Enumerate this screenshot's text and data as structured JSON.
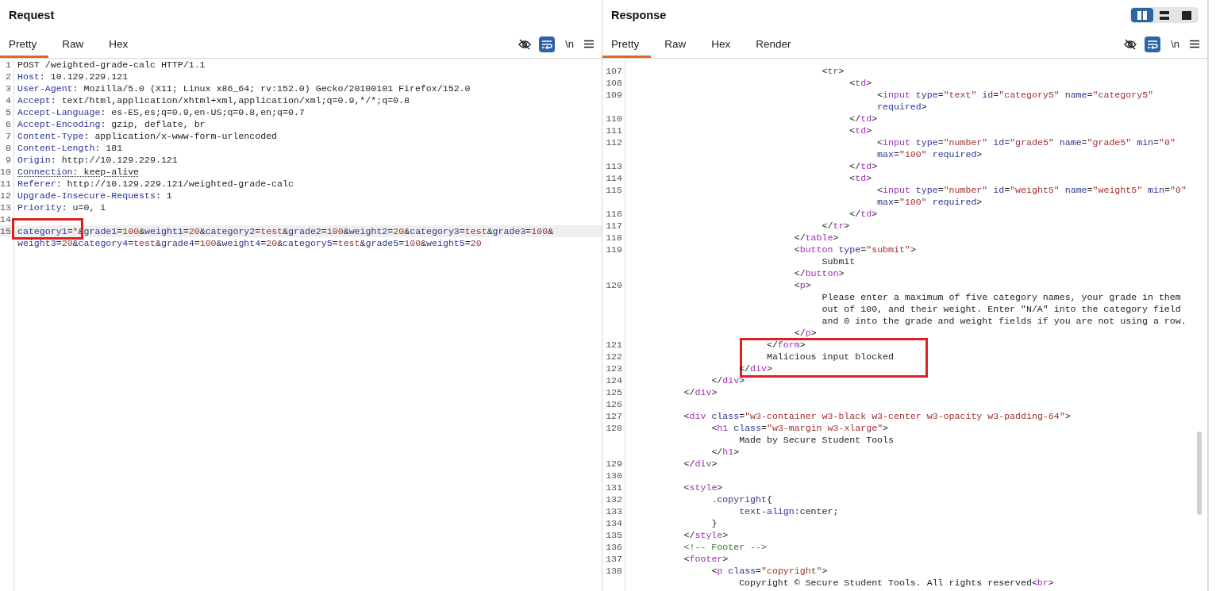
{
  "request": {
    "title": "Request",
    "tabs": [
      {
        "label": "Pretty",
        "selected": true
      },
      {
        "label": "Raw",
        "selected": false
      },
      {
        "label": "Hex",
        "selected": false
      }
    ],
    "toolbar": {
      "wrap": true,
      "newline_label": "\\n"
    },
    "lines": [
      {
        "n": "1",
        "tokens": [
          {
            "kind": "plain",
            "text": "POST /weighted-grade-calc HTTP/1.1"
          }
        ]
      },
      {
        "n": "2",
        "tokens": [
          {
            "kind": "attr",
            "text": "Host"
          },
          {
            "kind": "plain",
            "text": ": 10.129.229.121"
          }
        ]
      },
      {
        "n": "3",
        "tokens": [
          {
            "kind": "attr",
            "text": "User-Agent"
          },
          {
            "kind": "plain",
            "text": ": Mozilla/5.0 (X11; Linux x86_64; rv:152.0) Gecko/20100101 Firefox/152.0"
          }
        ]
      },
      {
        "n": "4",
        "tokens": [
          {
            "kind": "attr",
            "text": "Accept"
          },
          {
            "kind": "plain",
            "text": ": text/html,application/xhtml+xml,application/xml;q=0.9,*/*;q=0.8"
          }
        ]
      },
      {
        "n": "5",
        "tokens": [
          {
            "kind": "attr",
            "text": "Accept-Language"
          },
          {
            "kind": "plain",
            "text": ": es-ES,es;q=0.9,en-US;q=0.8,en;q=0.7"
          }
        ]
      },
      {
        "n": "6",
        "tokens": [
          {
            "kind": "attr",
            "text": "Accept-Encoding"
          },
          {
            "kind": "plain",
            "text": ": gzip, deflate, br"
          }
        ]
      },
      {
        "n": "7",
        "tokens": [
          {
            "kind": "attr",
            "text": "Content-Type"
          },
          {
            "kind": "plain",
            "text": ": application/x-www-form-urlencoded"
          }
        ]
      },
      {
        "n": "8",
        "tokens": [
          {
            "kind": "attr",
            "text": "Content-Length"
          },
          {
            "kind": "plain",
            "text": ": 181"
          }
        ]
      },
      {
        "n": "9",
        "tokens": [
          {
            "kind": "attr",
            "text": "Origin"
          },
          {
            "kind": "plain",
            "text": ": http://10.129.229.121"
          }
        ]
      },
      {
        "n": "10",
        "flagged": true,
        "tokens": [
          {
            "kind": "attr",
            "text": "Connection"
          },
          {
            "kind": "plain",
            "text": ": keep-alive"
          }
        ]
      },
      {
        "n": "11",
        "tokens": [
          {
            "kind": "attr",
            "text": "Referer"
          },
          {
            "kind": "plain",
            "text": ": http://10.129.229.121/weighted-grade-calc"
          }
        ]
      },
      {
        "n": "12",
        "tokens": [
          {
            "kind": "attr",
            "text": "Upgrade-Insecure-Requests"
          },
          {
            "kind": "plain",
            "text": ": 1"
          }
        ]
      },
      {
        "n": "13",
        "tokens": [
          {
            "kind": "attr",
            "text": "Priority"
          },
          {
            "kind": "plain",
            "text": ": u=0, i"
          }
        ]
      },
      {
        "n": "14"
      },
      {
        "n": "15",
        "current": true,
        "tokens": [
          {
            "kind": "attr",
            "text": "category1",
            "boxed": true
          },
          {
            "kind": "plain",
            "text": "=",
            "boxed": true
          },
          {
            "kind": "string",
            "text": "*",
            "boxed": true
          },
          {
            "kind": "plain",
            "text": "&"
          },
          {
            "kind": "attr",
            "text": "grade1"
          },
          {
            "kind": "plain",
            "text": "="
          },
          {
            "kind": "string",
            "text": "100"
          },
          {
            "kind": "plain",
            "text": "&"
          },
          {
            "kind": "attr",
            "text": "weight1"
          },
          {
            "kind": "plain",
            "text": "="
          },
          {
            "kind": "string",
            "text": "20"
          },
          {
            "kind": "plain",
            "text": "&"
          },
          {
            "kind": "attr",
            "text": "category2"
          },
          {
            "kind": "plain",
            "text": "="
          },
          {
            "kind": "string",
            "text": "test"
          },
          {
            "kind": "plain",
            "text": "&"
          },
          {
            "kind": "attr",
            "text": "grade2"
          },
          {
            "kind": "plain",
            "text": "="
          },
          {
            "kind": "string",
            "text": "100"
          },
          {
            "kind": "plain",
            "text": "&"
          },
          {
            "kind": "attr",
            "text": "weight2"
          },
          {
            "kind": "plain",
            "text": "="
          },
          {
            "kind": "string",
            "text": "20"
          },
          {
            "kind": "plain",
            "text": "&"
          },
          {
            "kind": "attr",
            "text": "category3"
          },
          {
            "kind": "plain",
            "text": "="
          },
          {
            "kind": "string",
            "text": "test"
          },
          {
            "kind": "plain",
            "text": "&"
          },
          {
            "kind": "attr",
            "text": "grade3"
          },
          {
            "kind": "plain",
            "text": "="
          },
          {
            "kind": "string",
            "text": "100"
          },
          {
            "kind": "plain",
            "text": "&"
          }
        ]
      },
      {
        "tokens": [
          {
            "kind": "attr",
            "text": "weight3"
          },
          {
            "kind": "plain",
            "text": "="
          },
          {
            "kind": "string",
            "text": "20"
          },
          {
            "kind": "plain",
            "text": "&"
          },
          {
            "kind": "attr",
            "text": "category4"
          },
          {
            "kind": "plain",
            "text": "="
          },
          {
            "kind": "string",
            "text": "test"
          },
          {
            "kind": "plain",
            "text": "&"
          },
          {
            "kind": "attr",
            "text": "grade4"
          },
          {
            "kind": "plain",
            "text": "="
          },
          {
            "kind": "string",
            "text": "100"
          },
          {
            "kind": "plain",
            "text": "&"
          },
          {
            "kind": "attr",
            "text": "weight4"
          },
          {
            "kind": "plain",
            "text": "="
          },
          {
            "kind": "string",
            "text": "20"
          },
          {
            "kind": "plain",
            "text": "&"
          },
          {
            "kind": "attr",
            "text": "category5"
          },
          {
            "kind": "plain",
            "text": "="
          },
          {
            "kind": "string",
            "text": "test"
          },
          {
            "kind": "plain",
            "text": "&"
          },
          {
            "kind": "attr",
            "text": "grade5"
          },
          {
            "kind": "plain",
            "text": "="
          },
          {
            "kind": "string",
            "text": "100"
          },
          {
            "kind": "plain",
            "text": "&"
          },
          {
            "kind": "attr",
            "text": "weight5"
          },
          {
            "kind": "plain",
            "text": "="
          },
          {
            "kind": "string",
            "text": "20"
          }
        ]
      }
    ]
  },
  "response": {
    "title": "Response",
    "layout_buttons": [
      {
        "kind": "columns",
        "selected": true
      },
      {
        "kind": "rows",
        "selected": false
      },
      {
        "kind": "single",
        "selected": false
      }
    ],
    "tabs": [
      {
        "label": "Pretty",
        "selected": true
      },
      {
        "label": "Raw",
        "selected": false
      },
      {
        "label": "Hex",
        "selected": false
      },
      {
        "label": "Render",
        "selected": false
      }
    ],
    "toolbar": {
      "wrap": true,
      "newline_label": "\\n"
    },
    "lines": [
      {
        "n": "107",
        "tokens": [
          {
            "kind": "plain",
            "text": "\t\t\t\t\t\t\t<"
          },
          {
            "kind": "tag",
            "text": "tr"
          },
          {
            "kind": "plain",
            "text": ">"
          }
        ]
      },
      {
        "n": "108",
        "tokens": [
          {
            "kind": "plain",
            "text": "\t\t\t\t\t\t\t\t<"
          },
          {
            "kind": "tag",
            "text": "td"
          },
          {
            "kind": "plain",
            "text": ">"
          }
        ]
      },
      {
        "n": "109",
        "tokens": [
          {
            "kind": "plain",
            "text": "\t\t\t\t\t\t\t\t\t<"
          },
          {
            "kind": "tag",
            "text": "input"
          },
          {
            "kind": "attr",
            "text": " type"
          },
          {
            "kind": "plain",
            "text": "="
          },
          {
            "kind": "string",
            "text": "\"text\""
          },
          {
            "kind": "attr",
            "text": " id"
          },
          {
            "kind": "plain",
            "text": "="
          },
          {
            "kind": "string",
            "text": "\"category5\""
          },
          {
            "kind": "attr",
            "text": " name"
          },
          {
            "kind": "plain",
            "text": "="
          },
          {
            "kind": "string",
            "text": "\"category5\""
          }
        ]
      },
      {
        "tokens": [
          {
            "kind": "attr",
            "text": "\t\t\t\t\t\t\t\t\trequired"
          },
          {
            "kind": "plain",
            "text": ">"
          }
        ]
      },
      {
        "n": "110",
        "tokens": [
          {
            "kind": "plain",
            "text": "\t\t\t\t\t\t\t\t</"
          },
          {
            "kind": "tag",
            "text": "td"
          },
          {
            "kind": "plain",
            "text": ">"
          }
        ]
      },
      {
        "n": "111",
        "tokens": [
          {
            "kind": "plain",
            "text": "\t\t\t\t\t\t\t\t<"
          },
          {
            "kind": "tag",
            "text": "td"
          },
          {
            "kind": "plain",
            "text": ">"
          }
        ]
      },
      {
        "n": "112",
        "tokens": [
          {
            "kind": "plain",
            "text": "\t\t\t\t\t\t\t\t\t<"
          },
          {
            "kind": "tag",
            "text": "input"
          },
          {
            "kind": "attr",
            "text": " type"
          },
          {
            "kind": "plain",
            "text": "="
          },
          {
            "kind": "string",
            "text": "\"number\""
          },
          {
            "kind": "attr",
            "text": " id"
          },
          {
            "kind": "plain",
            "text": "="
          },
          {
            "kind": "string",
            "text": "\"grade5\""
          },
          {
            "kind": "attr",
            "text": " name"
          },
          {
            "kind": "plain",
            "text": "="
          },
          {
            "kind": "string",
            "text": "\"grade5\""
          },
          {
            "kind": "attr",
            "text": " min"
          },
          {
            "kind": "plain",
            "text": "="
          },
          {
            "kind": "string",
            "text": "\"0\""
          }
        ]
      },
      {
        "tokens": [
          {
            "kind": "attr",
            "text": "\t\t\t\t\t\t\t\t\tmax"
          },
          {
            "kind": "plain",
            "text": "="
          },
          {
            "kind": "string",
            "text": "\"100\""
          },
          {
            "kind": "attr",
            "text": " required"
          },
          {
            "kind": "plain",
            "text": ">"
          }
        ]
      },
      {
        "n": "113",
        "tokens": [
          {
            "kind": "plain",
            "text": "\t\t\t\t\t\t\t\t</"
          },
          {
            "kind": "tag",
            "text": "td"
          },
          {
            "kind": "plain",
            "text": ">"
          }
        ]
      },
      {
        "n": "114",
        "tokens": [
          {
            "kind": "plain",
            "text": "\t\t\t\t\t\t\t\t<"
          },
          {
            "kind": "tag",
            "text": "td"
          },
          {
            "kind": "plain",
            "text": ">"
          }
        ]
      },
      {
        "n": "115",
        "tokens": [
          {
            "kind": "plain",
            "text": "\t\t\t\t\t\t\t\t\t<"
          },
          {
            "kind": "tag",
            "text": "input"
          },
          {
            "kind": "attr",
            "text": " type"
          },
          {
            "kind": "plain",
            "text": "="
          },
          {
            "kind": "string",
            "text": "\"number\""
          },
          {
            "kind": "attr",
            "text": " id"
          },
          {
            "kind": "plain",
            "text": "="
          },
          {
            "kind": "string",
            "text": "\"weight5\""
          },
          {
            "kind": "attr",
            "text": " name"
          },
          {
            "kind": "plain",
            "text": "="
          },
          {
            "kind": "string",
            "text": "\"weight5\""
          },
          {
            "kind": "attr",
            "text": " min"
          },
          {
            "kind": "plain",
            "text": "="
          },
          {
            "kind": "string",
            "text": "\"0\""
          }
        ]
      },
      {
        "tokens": [
          {
            "kind": "attr",
            "text": "\t\t\t\t\t\t\t\t\tmax"
          },
          {
            "kind": "plain",
            "text": "="
          },
          {
            "kind": "string",
            "text": "\"100\""
          },
          {
            "kind": "attr",
            "text": " required"
          },
          {
            "kind": "plain",
            "text": ">"
          }
        ]
      },
      {
        "n": "116",
        "tokens": [
          {
            "kind": "plain",
            "text": "\t\t\t\t\t\t\t\t</"
          },
          {
            "kind": "tag",
            "text": "td"
          },
          {
            "kind": "plain",
            "text": ">"
          }
        ]
      },
      {
        "n": "117",
        "tokens": [
          {
            "kind": "plain",
            "text": "\t\t\t\t\t\t\t</"
          },
          {
            "kind": "tag",
            "text": "tr"
          },
          {
            "kind": "plain",
            "text": ">"
          }
        ]
      },
      {
        "n": "118",
        "tokens": [
          {
            "kind": "plain",
            "text": "\t\t\t\t\t\t</"
          },
          {
            "kind": "tag",
            "text": "table"
          },
          {
            "kind": "plain",
            "text": ">"
          }
        ]
      },
      {
        "n": "119",
        "tokens": [
          {
            "kind": "plain",
            "text": "\t\t\t\t\t\t<"
          },
          {
            "kind": "tag",
            "text": "button"
          },
          {
            "kind": "attr",
            "text": " type"
          },
          {
            "kind": "plain",
            "text": "="
          },
          {
            "kind": "string",
            "text": "\"submit\""
          },
          {
            "kind": "plain",
            "text": ">"
          }
        ]
      },
      {
        "tokens": [
          {
            "kind": "plain",
            "text": "\t\t\t\t\t\t\tSubmit"
          }
        ]
      },
      {
        "tokens": [
          {
            "kind": "plain",
            "text": "\t\t\t\t\t\t</"
          },
          {
            "kind": "tag",
            "text": "button"
          },
          {
            "kind": "plain",
            "text": ">"
          }
        ]
      },
      {
        "n": "120",
        "tokens": [
          {
            "kind": "plain",
            "text": "\t\t\t\t\t\t<"
          },
          {
            "kind": "tag",
            "text": "p"
          },
          {
            "kind": "plain",
            "text": ">"
          }
        ]
      },
      {
        "tokens": [
          {
            "kind": "plain",
            "text": "\t\t\t\t\t\t\tPlease enter a maximum of five category names, your grade in them"
          }
        ]
      },
      {
        "tokens": [
          {
            "kind": "plain",
            "text": "\t\t\t\t\t\t\tout of 100, and their weight. Enter \"N/A\" into the category field"
          }
        ]
      },
      {
        "tokens": [
          {
            "kind": "plain",
            "text": "\t\t\t\t\t\t\tand 0 into the grade and weight fields if you are not using a row."
          }
        ]
      },
      {
        "tokens": [
          {
            "kind": "plain",
            "text": "\t\t\t\t\t\t</"
          },
          {
            "kind": "tag",
            "text": "p"
          },
          {
            "kind": "plain",
            "text": ">"
          }
        ]
      },
      {
        "n": "121",
        "boxed": true,
        "tokens": [
          {
            "kind": "plain",
            "text": "\t\t\t\t\t</"
          },
          {
            "kind": "tag",
            "text": "form"
          },
          {
            "kind": "plain",
            "text": ">"
          }
        ]
      },
      {
        "n": "122",
        "boxed": true,
        "tokens": [
          {
            "kind": "plain",
            "text": "\t\t\t\t\tMalicious input blocked"
          }
        ]
      },
      {
        "n": "123",
        "boxed": true,
        "tokens": [
          {
            "kind": "plain",
            "text": "\t\t\t\t</"
          },
          {
            "kind": "tag",
            "text": "div"
          },
          {
            "kind": "plain",
            "text": ">"
          }
        ]
      },
      {
        "n": "124",
        "tokens": [
          {
            "kind": "plain",
            "text": "\t\t\t</"
          },
          {
            "kind": "tag",
            "text": "div"
          },
          {
            "kind": "plain",
            "text": ">"
          }
        ]
      },
      {
        "n": "125",
        "tokens": [
          {
            "kind": "plain",
            "text": "\t\t</"
          },
          {
            "kind": "tag",
            "text": "div"
          },
          {
            "kind": "plain",
            "text": ">"
          }
        ]
      },
      {
        "n": "126"
      },
      {
        "n": "127",
        "tokens": [
          {
            "kind": "plain",
            "text": "\t\t<"
          },
          {
            "kind": "tag",
            "text": "div"
          },
          {
            "kind": "attr",
            "text": " class"
          },
          {
            "kind": "plain",
            "text": "="
          },
          {
            "kind": "string",
            "text": "\"w3-container w3-black w3-center w3-opacity w3-padding-64\""
          },
          {
            "kind": "plain",
            "text": ">"
          }
        ]
      },
      {
        "n": "128",
        "tokens": [
          {
            "kind": "plain",
            "text": "\t\t\t<"
          },
          {
            "kind": "tag",
            "text": "h1"
          },
          {
            "kind": "attr",
            "text": " class"
          },
          {
            "kind": "plain",
            "text": "="
          },
          {
            "kind": "string",
            "text": "\"w3-margin w3-xlarge\""
          },
          {
            "kind": "plain",
            "text": ">"
          }
        ]
      },
      {
        "tokens": [
          {
            "kind": "plain",
            "text": "\t\t\t\tMade by Secure Student Tools"
          }
        ]
      },
      {
        "tokens": [
          {
            "kind": "plain",
            "text": "\t\t\t</"
          },
          {
            "kind": "tag",
            "text": "h1"
          },
          {
            "kind": "plain",
            "text": ">"
          }
        ]
      },
      {
        "n": "129",
        "tokens": [
          {
            "kind": "plain",
            "text": "\t\t</"
          },
          {
            "kind": "tag",
            "text": "div"
          },
          {
            "kind": "plain",
            "text": ">"
          }
        ]
      },
      {
        "n": "130"
      },
      {
        "n": "131",
        "tokens": [
          {
            "kind": "plain",
            "text": "\t\t<"
          },
          {
            "kind": "tag",
            "text": "style"
          },
          {
            "kind": "plain",
            "text": ">"
          }
        ]
      },
      {
        "n": "132",
        "tokens": [
          {
            "kind": "attr",
            "text": "\t\t\t.copyright"
          },
          {
            "kind": "plain",
            "text": "{"
          }
        ]
      },
      {
        "n": "133",
        "tokens": [
          {
            "kind": "attr",
            "text": "\t\t\t\ttext-align"
          },
          {
            "kind": "plain",
            "text": ":center;"
          }
        ]
      },
      {
        "n": "134",
        "tokens": [
          {
            "kind": "plain",
            "text": "\t\t\t}"
          }
        ]
      },
      {
        "n": "135",
        "tokens": [
          {
            "kind": "plain",
            "text": "\t\t</"
          },
          {
            "kind": "tag",
            "text": "style"
          },
          {
            "kind": "plain",
            "text": ">"
          }
        ]
      },
      {
        "n": "136",
        "tokens": [
          {
            "kind": "comment",
            "text": "\t\t<!-- Footer -->"
          }
        ]
      },
      {
        "n": "137",
        "tokens": [
          {
            "kind": "plain",
            "text": "\t\t<"
          },
          {
            "kind": "tag",
            "text": "footer"
          },
          {
            "kind": "plain",
            "text": ">"
          }
        ]
      },
      {
        "n": "138",
        "tokens": [
          {
            "kind": "plain",
            "text": "\t\t\t<"
          },
          {
            "kind": "tag",
            "text": "p"
          },
          {
            "kind": "attr",
            "text": " class"
          },
          {
            "kind": "plain",
            "text": "="
          },
          {
            "kind": "string",
            "text": "\"copyright\""
          },
          {
            "kind": "plain",
            "text": ">"
          }
        ]
      },
      {
        "tokens": [
          {
            "kind": "plain",
            "text": "\t\t\t\tCopyright © Secure Student Tools. All rights reserved<"
          },
          {
            "kind": "tag",
            "text": "br"
          },
          {
            "kind": "plain",
            "text": ">"
          }
        ]
      }
    ]
  }
}
